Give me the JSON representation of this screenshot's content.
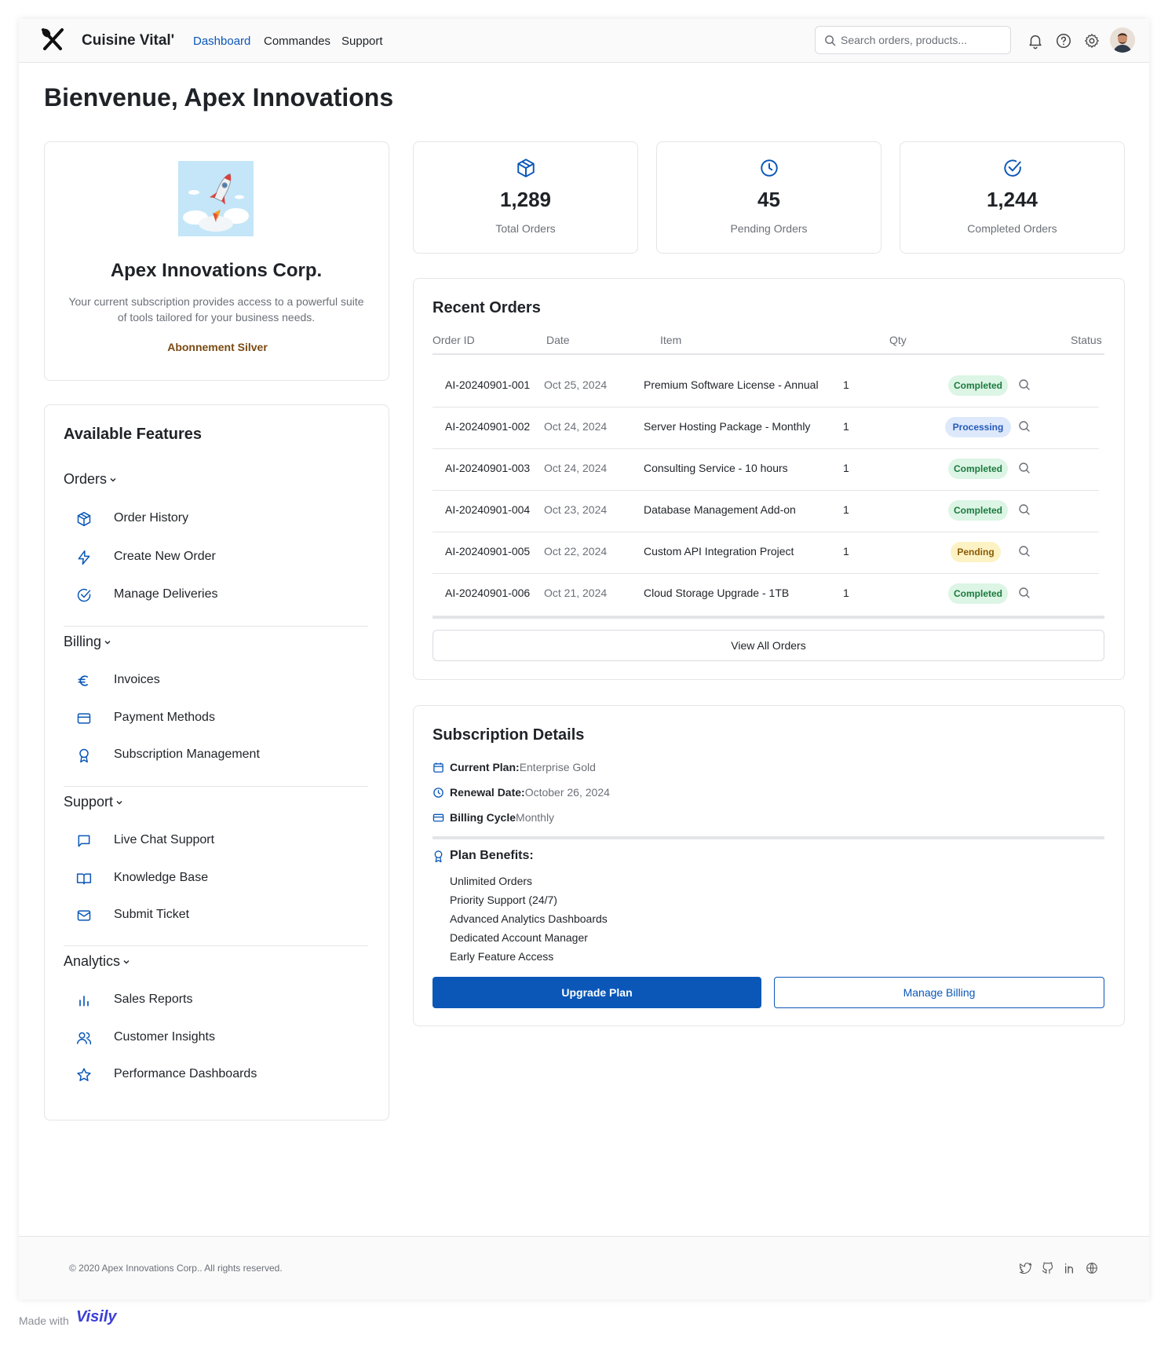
{
  "header": {
    "brand": "Cuisine Vital'",
    "nav": [
      "Dashboard",
      "Commandes",
      "Support"
    ],
    "active_nav": "Dashboard",
    "search_placeholder": "Search orders, products...",
    "icons": [
      "bell-icon",
      "help-icon",
      "gear-icon"
    ]
  },
  "welcome": "Bienvenue, Apex Innovations",
  "profile": {
    "company": "Apex Innovations Corp.",
    "description": "Your current subscription provides access to a powerful suite of tools tailored for your business needs.",
    "plan_tag": "Abonnement Silver"
  },
  "features": {
    "title": "Available Features",
    "groups": [
      {
        "label": "Orders",
        "items": [
          {
            "label": "Order History",
            "icon": "package-icon"
          },
          {
            "label": "Create New Order",
            "icon": "bolt-icon"
          },
          {
            "label": "Manage Deliveries",
            "icon": "check-circle-icon"
          }
        ]
      },
      {
        "label": "Billing",
        "items": [
          {
            "label": "Invoices",
            "icon": "euro-icon"
          },
          {
            "label": "Payment Methods",
            "icon": "credit-card-icon"
          },
          {
            "label": "Subscription Management",
            "icon": "award-icon"
          }
        ]
      },
      {
        "label": "Support",
        "items": [
          {
            "label": "Live Chat Support",
            "icon": "chat-icon"
          },
          {
            "label": "Knowledge Base",
            "icon": "book-icon"
          },
          {
            "label": "Submit Ticket",
            "icon": "mail-icon"
          }
        ]
      },
      {
        "label": "Analytics",
        "items": [
          {
            "label": "Sales Reports",
            "icon": "bar-chart-icon"
          },
          {
            "label": "Customer Insights",
            "icon": "users-icon"
          },
          {
            "label": "Performance Dashboards",
            "icon": "star-icon"
          }
        ]
      }
    ]
  },
  "stats": [
    {
      "value": "1,289",
      "label": "Total Orders",
      "icon": "package-icon"
    },
    {
      "value": "45",
      "label": "Pending Orders",
      "icon": "clock-icon"
    },
    {
      "value": "1,244",
      "label": "Completed Orders",
      "icon": "check-circle-icon"
    }
  ],
  "recent_orders": {
    "title": "Recent Orders",
    "columns": [
      "Order ID",
      "Date",
      "Item",
      "Qty",
      "Status"
    ],
    "rows": [
      {
        "id": "AI-20240901-001",
        "date": "Oct 25, 2024",
        "item": "Premium Software License - Annual",
        "qty": "1",
        "status": "Completed"
      },
      {
        "id": "AI-20240901-002",
        "date": "Oct 24, 2024",
        "item": "Server Hosting Package - Monthly",
        "qty": "1",
        "status": "Processing"
      },
      {
        "id": "AI-20240901-003",
        "date": "Oct 24, 2024",
        "item": "Consulting Service - 10 hours",
        "qty": "1",
        "status": "Completed"
      },
      {
        "id": "AI-20240901-004",
        "date": "Oct 23, 2024",
        "item": "Database Management Add-on",
        "qty": "1",
        "status": "Completed"
      },
      {
        "id": "AI-20240901-005",
        "date": "Oct 22, 2024",
        "item": "Custom API Integration Project",
        "qty": "1",
        "status": "Pending"
      },
      {
        "id": "AI-20240901-006",
        "date": "Oct 21, 2024",
        "item": "Cloud Storage Upgrade - 1TB",
        "qty": "1",
        "status": "Completed"
      }
    ],
    "view_all": "View All Orders"
  },
  "subscription": {
    "title": "Subscription Details",
    "current_plan_label": "Current Plan:",
    "current_plan": "Enterprise Gold",
    "renewal_label": "Renewal Date:",
    "renewal_date": "October 26, 2024",
    "billing_label": "Billing Cycle",
    "billing_cycle": "Monthly",
    "benefits_title": "Plan Benefits:",
    "benefits": [
      "Unlimited Orders",
      "Priority Support (24/7)",
      "Advanced Analytics Dashboards",
      "Dedicated Account Manager",
      "Early Feature Access"
    ],
    "upgrade": "Upgrade Plan",
    "manage_billing": "Manage Billing"
  },
  "footer": {
    "copyright": "© 2020 Apex Innovations Corp.. All rights reserved.",
    "social": [
      "twitter-icon",
      "github-icon",
      "linkedin-icon",
      "globe-icon"
    ]
  },
  "made_with": "Made with",
  "visily": "Visily",
  "colors": {
    "accent": "#0a57b8",
    "completed_bg": "#dcf5e5",
    "processing_bg": "#dde8fb",
    "pending_bg": "#fdf2c4"
  }
}
